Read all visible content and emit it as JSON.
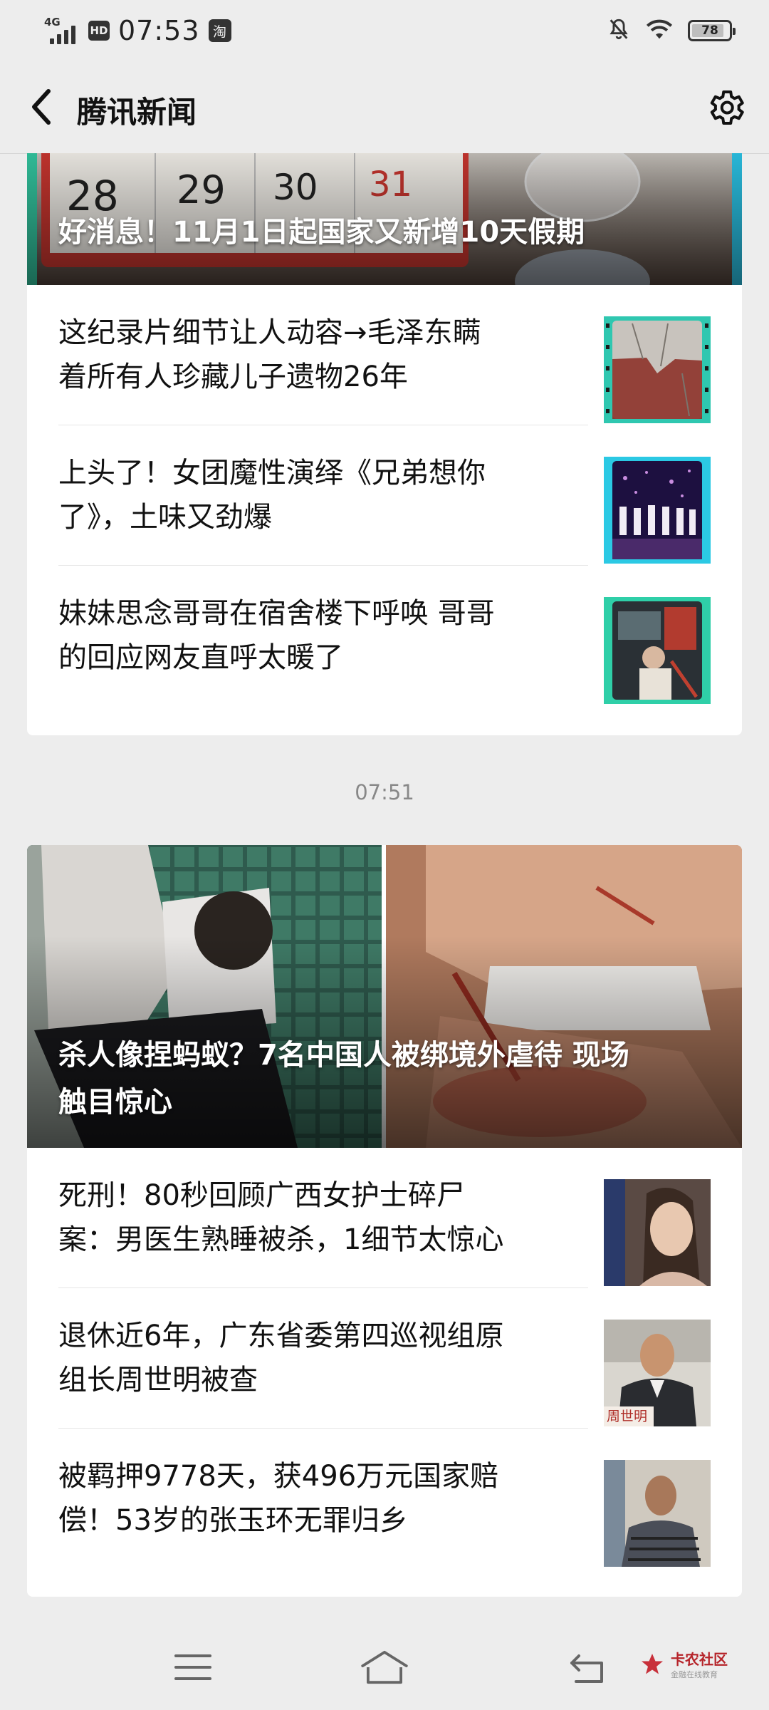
{
  "status_bar": {
    "network": "4G",
    "hd_label": "HD",
    "time": "07:53",
    "app_badge": "淘",
    "battery": "78",
    "icons": [
      "signal-icon",
      "hd-icon",
      "taobao-icon",
      "mute-icon",
      "wifi-icon",
      "battery-icon"
    ]
  },
  "header": {
    "title": "腾讯新闻",
    "back_icon": "chevron-left-icon",
    "settings_icon": "gear-icon"
  },
  "feed": {
    "block1": {
      "headline": "好消息！11月1日起国家又新增10天假期",
      "items": [
        {
          "title": "这纪录片细节让人动容→毛泽东瞒着所有人珍藏儿子遗物26年",
          "lines": [
            "这纪录片细节让人动容→毛泽东瞒",
            "着所有人珍藏儿子遗物26年"
          ]
        },
        {
          "title": "上头了！女团魔性演绎《兄弟想你了》，土味又劲爆",
          "lines": [
            "上头了！女团魔性演绎《兄弟想你",
            "了》，土味又劲爆"
          ]
        },
        {
          "title": "妹妹思念哥哥在宿舍楼下呼唤 哥哥的回应网友直呼太暖了",
          "lines": [
            "妹妹思念哥哥在宿舍楼下呼唤 哥哥",
            "的回应网友直呼太暖了"
          ]
        }
      ]
    },
    "time_separator": "07:51",
    "block2": {
      "headline": "杀人像捏蚂蚁？7名中国人被绑境外虐待 现场触目惊心",
      "headline_lines": [
        "杀人像捏蚂蚁？7名中国人被绑境外虐待 现场",
        "触目惊心"
      ],
      "items": [
        {
          "title": "死刑！80秒回顾广西女护士碎尸案：男医生熟睡被杀，1细节太惊心",
          "lines": [
            "死刑！80秒回顾广西女护士碎尸",
            "案：男医生熟睡被杀，1细节太惊心"
          ]
        },
        {
          "title": "退休近6年，广东省委第四巡视组原组长周世明被查",
          "lines": [
            "退休近6年，广东省委第四巡视组原",
            "组长周世明被查"
          ],
          "thumb_caption": "周世明"
        },
        {
          "title": "被羁押9778天，获496万元国家赔偿！53岁的张玉环无罪归乡",
          "lines": [
            "被羁押9778天，获496万元国家赔",
            "偿！53岁的张玉环无罪归乡"
          ]
        }
      ]
    }
  },
  "nav_bar": {
    "icons": [
      "menu-icon",
      "home-icon",
      "back-arrow-icon"
    ],
    "watermark_main": "卡农社区",
    "watermark_sub": "金融在线教育"
  }
}
